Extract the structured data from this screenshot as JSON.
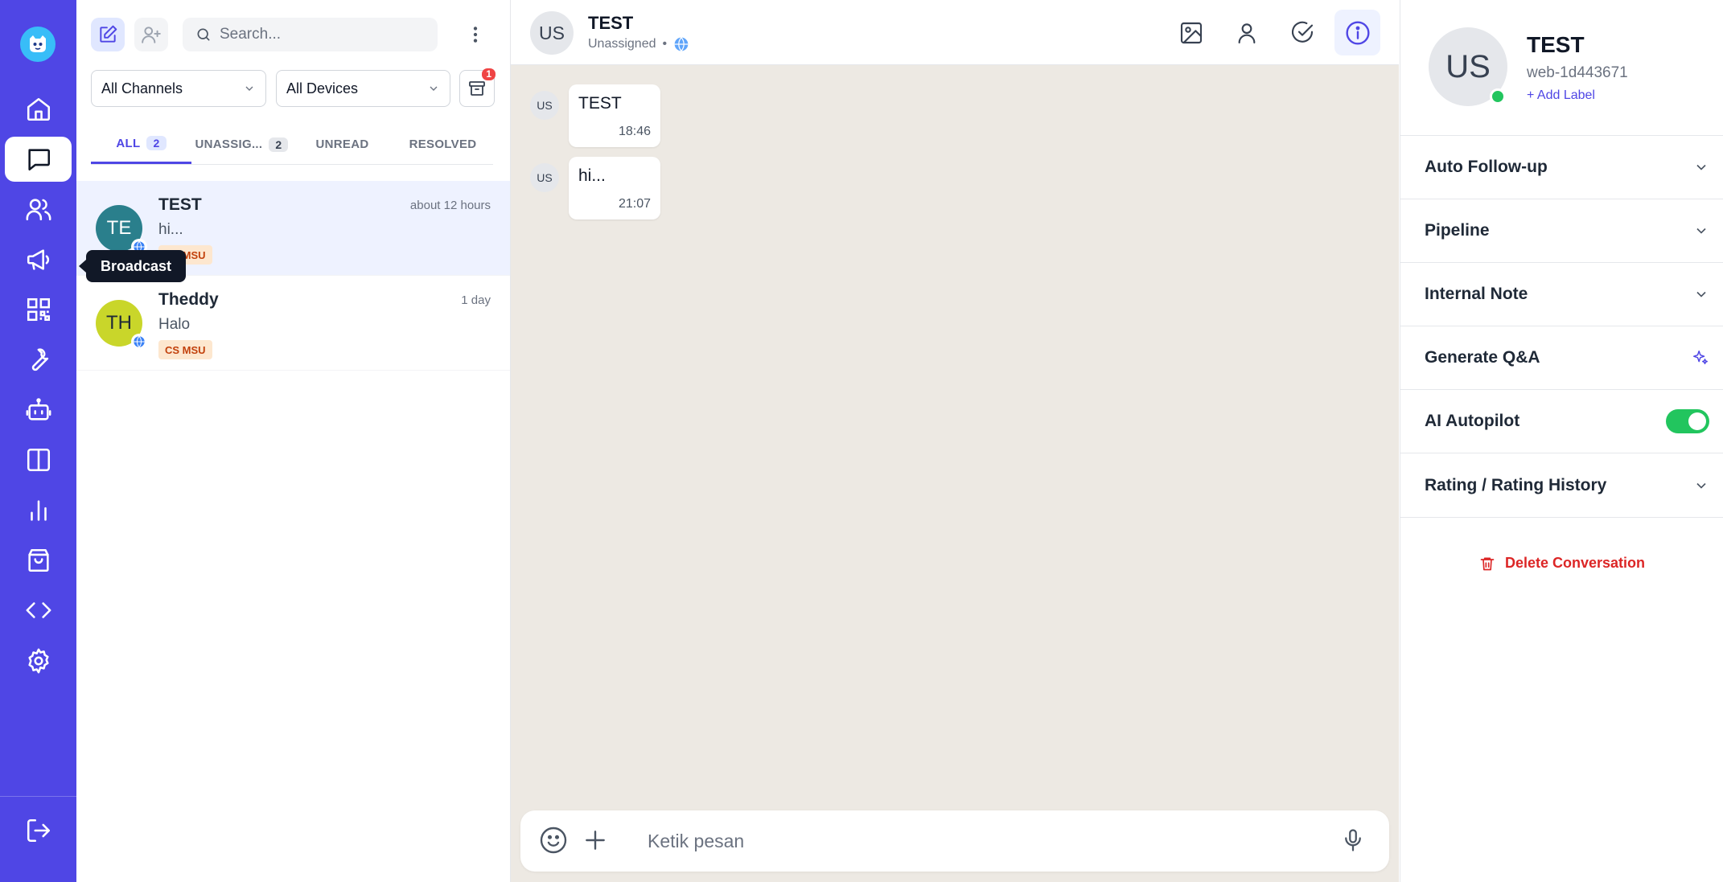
{
  "nav": {
    "items": [
      "home",
      "chats",
      "contacts",
      "broadcast",
      "qr-code",
      "tools",
      "bot",
      "layout",
      "analytics",
      "shop",
      "developer",
      "settings"
    ],
    "active": "chats",
    "tooltip": "Broadcast",
    "colors": {
      "background": "#4f46e5"
    }
  },
  "list": {
    "search_placeholder": "Search...",
    "channel_filter": "All Channels",
    "device_filter": "All Devices",
    "archive_badge": "1",
    "tabs": [
      {
        "label": "ALL",
        "count": "2"
      },
      {
        "label": "UNASSIG...",
        "count": "2"
      },
      {
        "label": "UNREAD",
        "count": ""
      },
      {
        "label": "RESOLVED",
        "count": ""
      }
    ],
    "conversations": [
      {
        "initials": "TE",
        "name": "TEST",
        "time": "about 12 hours",
        "preview": "hi...",
        "label": "CS MSU",
        "avatar_color": "#2a7f8c"
      },
      {
        "initials": "TH",
        "name": "Theddy",
        "time": "1 day",
        "preview": "Halo",
        "label": "CS MSU",
        "avatar_color": "#c9d62a"
      }
    ]
  },
  "chat": {
    "initials": "US",
    "title": "TEST",
    "status": "Unassigned",
    "messages": [
      {
        "initials": "US",
        "text": "TEST",
        "time": "18:46"
      },
      {
        "initials": "US",
        "text": "hi...",
        "time": "21:07"
      }
    ],
    "composer_placeholder": "Ketik pesan"
  },
  "details": {
    "initials": "US",
    "name": "TEST",
    "id": "web-1d443671",
    "add_label": "+ Add Label",
    "sections": [
      "Auto Follow-up",
      "Pipeline",
      "Internal Note",
      "Generate Q&A",
      "AI Autopilot",
      "Rating / Rating History"
    ],
    "ai_autopilot_enabled": true,
    "delete_label": "Delete Conversation"
  }
}
